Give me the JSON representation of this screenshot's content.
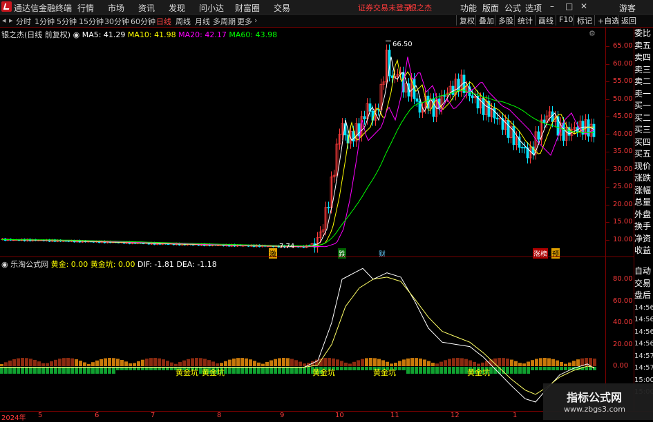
{
  "app": {
    "title": "通达信金融终端"
  },
  "menu": [
    "行情",
    "市场",
    "资讯",
    "发现",
    "问小达",
    "财富圈",
    "交易"
  ],
  "alert_text": "证券交易未登录",
  "stock_name_top": "银之杰",
  "top_right": [
    "功能",
    "版面",
    "公式",
    "选项"
  ],
  "guest": "游客",
  "periods": [
    "分时",
    "1分钟",
    "5分钟",
    "15分钟",
    "30分钟",
    "60分钟",
    "日线",
    "周线",
    "月线",
    "多周期",
    "更多"
  ],
  "active_period": "日线",
  "right_buttons": [
    "复权",
    "叠加",
    "多股",
    "统计",
    "画线",
    "F10",
    "标记",
    "+自选",
    "返回"
  ],
  "main_legend": {
    "name": "银之杰(日线 前复权)",
    "ma5": "MA5: 41.29",
    "ma10": "MA10: 41.98",
    "ma20": "MA20: 42.17",
    "ma60": "MA60: 43.98",
    "peak_label": "66.50",
    "low_label": "7.74"
  },
  "price_ticks": [
    "65.00",
    "60.00",
    "55.00",
    "50.00",
    "45.00",
    "40.00",
    "35.00",
    "30.00",
    "25.00",
    "20.00",
    "15.00",
    "10.00"
  ],
  "event_marks": [
    "激",
    "跌",
    "财",
    "涨榜",
    "预"
  ],
  "sub_legend": {
    "name": "乐淘公式网",
    "hj": "黄金: 0.00",
    "hjk": "黄金坑: 0.00",
    "dif": "DIF: -1.81",
    "dea": "DEA: -1.18"
  },
  "sub_ticks": [
    "80.00",
    "60.00",
    "40.00",
    "20.00",
    "0.00"
  ],
  "pit_labels": [
    "黄金坑",
    "黄金坑",
    "黄金坑",
    "黄金坑",
    "黄金坑"
  ],
  "dates": [
    "2024年",
    "5",
    "6",
    "7",
    "8",
    "9",
    "10",
    "11",
    "12",
    "1"
  ],
  "right_panel_top": [
    "委比",
    "卖五",
    "卖四",
    "卖三",
    "卖二",
    "卖一",
    "买一",
    "买二",
    "买三",
    "买四",
    "买五",
    "现价",
    "涨跌",
    "涨幅",
    "总量",
    "外盘",
    "换手",
    "净资",
    "收益"
  ],
  "right_panel_bottom": [
    "自动",
    "交易",
    "盘后",
    "14:56",
    "14:56",
    "14:56",
    "14:56",
    "14:57",
    "14:57",
    "15:00",
    "15:00"
  ],
  "watermark": {
    "title": "指标公式网",
    "url": "www.zbgs3.com"
  },
  "colors": {
    "ma5": "#ffffff",
    "ma10": "#ffff00",
    "ma20": "#ff00ff",
    "ma60": "#00ff00",
    "up": "#ff3b3b",
    "down": "#00e5ff",
    "grid": "#7a0000"
  }
}
